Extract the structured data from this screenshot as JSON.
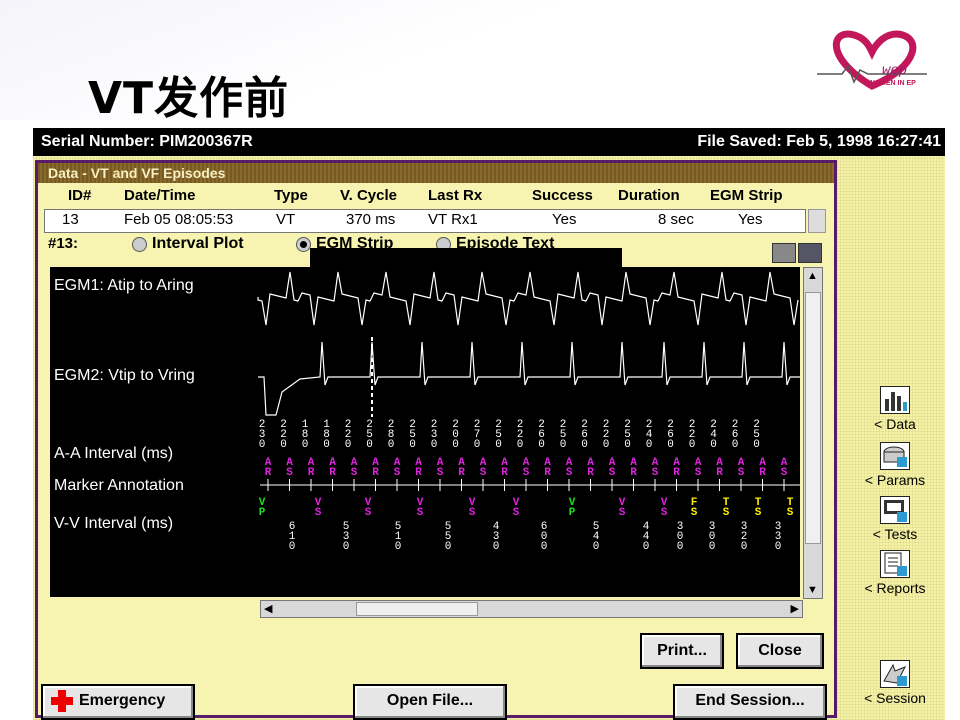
{
  "slide": {
    "title": "VT发作前",
    "logo_text": "WOMEN IN EP"
  },
  "topbar": {
    "serial": "Serial Number: PIM200367R",
    "saved": "File Saved: Feb 5, 1998  16:27:41"
  },
  "panel": {
    "title": "Data - VT and VF Episodes",
    "headers": [
      "ID#",
      "Date/Time",
      "Type",
      "V. Cycle",
      "Last Rx",
      "Success",
      "Duration",
      "EGM Strip"
    ],
    "row": [
      "13",
      "Feb 05  08:05:53",
      "VT",
      "370 ms",
      "VT   Rx1",
      "Yes",
      "8 sec",
      "Yes"
    ],
    "episode_label": "#13:",
    "options": [
      "Interval Plot",
      "EGM Strip",
      "Episode Text"
    ],
    "selected_option": "EGM Strip"
  },
  "strip": {
    "egm1_label": "EGM1: Atip to Aring",
    "egm2_label": "EGM2: Vtip to Vring",
    "aa_label": "A-A Interval (ms)",
    "marker_label": "Marker Annotation",
    "vv_label": "V-V Interval (ms)",
    "aa_intervals": [
      "230",
      "220",
      "180",
      "180",
      "220",
      "250",
      "280",
      "250",
      "230",
      "200",
      "270",
      "250",
      "220",
      "260",
      "250",
      "260",
      "220",
      "250",
      "240",
      "260",
      "220",
      "240",
      "260",
      "250"
    ],
    "a_markers": [
      "AR",
      "AS",
      "AR",
      "AR",
      "AS",
      "AR",
      "AS",
      "AR",
      "AS",
      "AR",
      "AS",
      "AR",
      "AS",
      "AR",
      "AS",
      "AR",
      "AS",
      "AR",
      "AS",
      "AR",
      "AS",
      "AR",
      "AS",
      "AR",
      "AS"
    ],
    "v_markers": [
      {
        "top": "V",
        "bot": "P",
        "color": "#22dd22"
      },
      {
        "top": "V",
        "bot": "S",
        "color": "#dd22dd"
      },
      {
        "top": "V",
        "bot": "S",
        "color": "#dd22dd"
      },
      {
        "top": "V",
        "bot": "S",
        "color": "#dd22dd"
      },
      {
        "top": "V",
        "bot": "S",
        "color": "#dd22dd"
      },
      {
        "top": "V",
        "bot": "S",
        "color": "#dd22dd"
      },
      {
        "top": "V",
        "bot": "P",
        "color": "#22dd22"
      },
      {
        "top": "V",
        "bot": "S",
        "color": "#dd22dd"
      },
      {
        "top": "V",
        "bot": "S",
        "color": "#dd22dd"
      },
      {
        "top": "F",
        "bot": "S",
        "color": "#ffee00"
      },
      {
        "top": "T",
        "bot": "S",
        "color": "#ffee00"
      },
      {
        "top": "T",
        "bot": "S",
        "color": "#ffee00"
      },
      {
        "top": "T",
        "bot": "S",
        "color": "#ffee00"
      }
    ],
    "vv_intervals": [
      "610",
      "530",
      "510",
      "550",
      "430",
      "600",
      "540",
      "440",
      "300",
      "300",
      "320",
      "330"
    ]
  },
  "buttons": {
    "print": "Print...",
    "close": "Close",
    "emergency": "Emergency",
    "open_file": "Open File...",
    "end_session": "End Session..."
  },
  "sidebar": {
    "data": "< Data",
    "params": "< Params",
    "tests": "< Tests",
    "reports": "< Reports",
    "session": "< Session"
  },
  "colors": {
    "app_bg": "#f6f2a4",
    "panel_border": "#5a1a6a",
    "a_marker": "#dd22dd",
    "v_pace": "#22dd22",
    "v_tach": "#ffee00"
  }
}
